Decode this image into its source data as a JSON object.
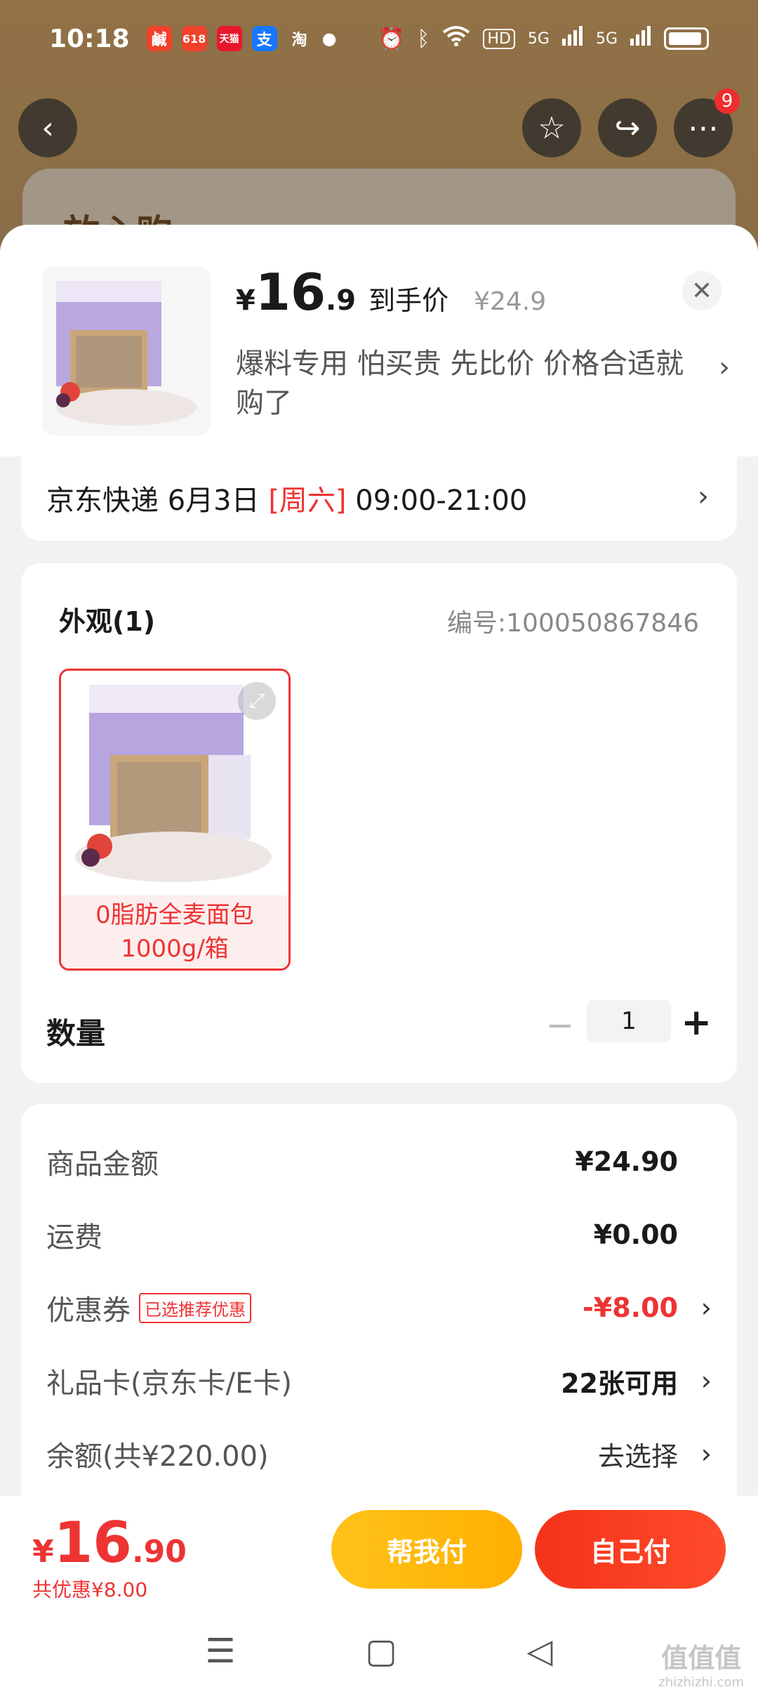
{
  "status": {
    "time": "10:18",
    "apps": [
      {
        "name": "xianyu-icon",
        "label": "鹹",
        "color": "#f0412a"
      },
      {
        "name": "618-icon",
        "label": "618",
        "color": "#f0412a"
      },
      {
        "name": "tmall-icon",
        "label": "天猫",
        "color": "#e8172c"
      },
      {
        "name": "alipay-icon",
        "label": "支",
        "color": "#1677ff"
      },
      {
        "name": "taobao-icon",
        "label": "淘",
        "color": "transparent"
      }
    ],
    "right_icons": [
      "alarm-icon",
      "bluetooth-icon",
      "wifi-icon",
      "hd-icon",
      "signal-5g-icon",
      "signal-5g-icon",
      "battery-icon"
    ],
    "hd_label": "HD",
    "signal_label_1": "5G",
    "signal_label_2": "5G"
  },
  "nav": {
    "more_badge": "9"
  },
  "background": {
    "card_title": "放心购"
  },
  "sheet": {
    "price_yen": "¥",
    "price_int": "16",
    "price_dec": ".9",
    "price_tag": "到手价",
    "price_original": "¥24.9",
    "promo_text": "爆料专用 怕买贵 先比价 价格合适就购了",
    "delivery": {
      "prefix": "京东快递 6月3日 ",
      "weekday": "[周六]",
      "time": " 09:00-21:00"
    },
    "spec": {
      "title": "外观(1)",
      "sku": "编号:100050867846",
      "variant_label_line1": "0脂肪全麦面包",
      "variant_label_line2": "1000g/箱"
    },
    "quantity": {
      "label": "数量",
      "value": "1",
      "minus": "−",
      "plus": "+"
    },
    "summary": {
      "goods_label": "商品金额",
      "goods_value": "¥24.90",
      "shipping_label": "运费",
      "shipping_value": "¥0.00",
      "coupon_label": "优惠券",
      "coupon_badge": "已选推荐优惠",
      "coupon_value": "-¥8.00",
      "giftcard_label": "礼品卡(京东卡/E卡)",
      "giftcard_value": "22张可用",
      "balance_label": "余额(共¥220.00)",
      "balance_value": "去选择"
    }
  },
  "bottom": {
    "total_yen": "¥",
    "total_int": "16",
    "total_dec": ".90",
    "discount": "共优惠¥8.00",
    "help_pay": "帮我付",
    "self_pay": "自己付"
  },
  "watermark": {
    "title": "值值值",
    "url": "zhizhizhi.com"
  },
  "colors": {
    "accent_red": "#e33333",
    "help_button": "#ffb000",
    "self_button": "#f3331a"
  }
}
